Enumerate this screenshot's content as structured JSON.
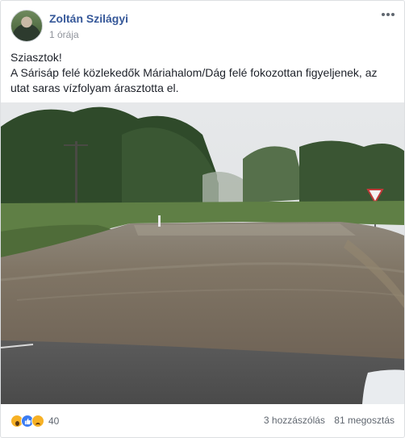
{
  "post": {
    "author": "Zoltán Szilágyi",
    "timestamp": "1 órája",
    "text_lines": [
      "Sziasztok!",
      "A Sárisáp felé közlekedők Máriahalom/Dág felé fokozottan figyeljenek, az utat saras vízfolyam árasztotta el."
    ]
  },
  "icons": {
    "more_options": "more-options-icon",
    "reactions": [
      "wow-reaction-icon",
      "like-reaction-icon",
      "sad-reaction-icon"
    ]
  },
  "footer": {
    "reaction_count": "40",
    "comments": "3 hozzászólás",
    "shares": "81 megosztás"
  },
  "colors": {
    "author_link": "#365899",
    "meta_text": "#90949c",
    "like_blue": "#3b7cf2",
    "reaction_yellow": "#f7b125"
  }
}
